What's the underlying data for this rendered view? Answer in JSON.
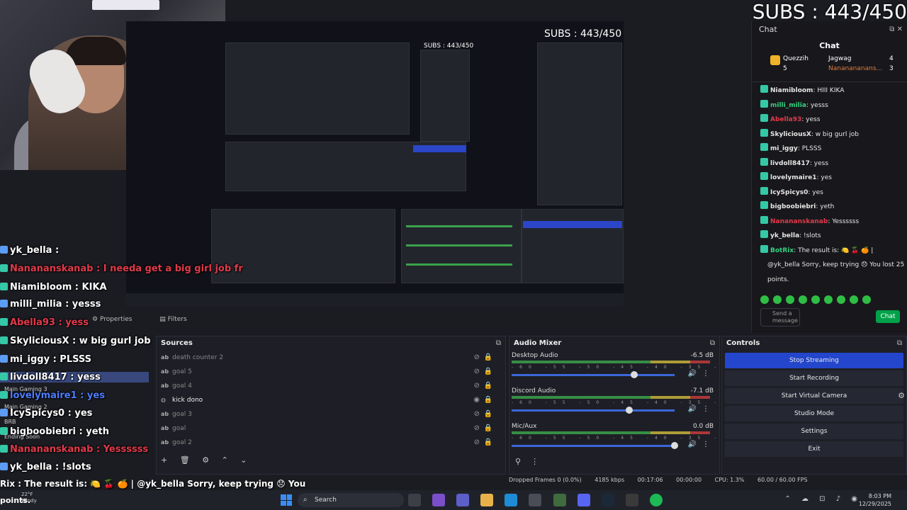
{
  "subs_overlay": {
    "text": "SUBS : 443/450",
    "mini_text": "SUBS : 443/450",
    "mini_text2": "SUBS : 443/450"
  },
  "overlay_chat": [
    {
      "name": "yk_bella",
      "text": "yk_bella :",
      "color": "white"
    },
    {
      "name": "Nanananskanab",
      "text": "Nanananskanab : I needa get a big girl job fr",
      "color": "red"
    },
    {
      "name": "Niamibloom",
      "text": "Niamibloom : KIKA",
      "color": "white"
    },
    {
      "name": "milli_milia",
      "text": "milli_milia : yesss",
      "color": "white"
    },
    {
      "name": "Abella93",
      "text": "Abella93 : yess",
      "color": "red"
    },
    {
      "name": "SkyliciousX",
      "text": "SkyliciousX : w big gurl job",
      "color": "white"
    },
    {
      "name": "mi_iggy",
      "text": "mi_iggy : PLSSS",
      "color": "white"
    },
    {
      "name": "livdoll8417",
      "text": "livdoll8417 : yess",
      "color": "white"
    },
    {
      "name": "lovelymaire1",
      "text": "lovelymaire1 : yes",
      "color": "blue"
    },
    {
      "name": "IcySpicys0",
      "text": "IcySpicys0 : yes",
      "color": "white"
    },
    {
      "name": "bigboobiebri",
      "text": "bigboobiebri : yeth",
      "color": "white"
    },
    {
      "name": "Nanananskanab",
      "text": "Nanananskanab : Yessssss",
      "color": "red"
    },
    {
      "name": "yk_bella",
      "text": "yk_bella : !slots",
      "color": "white"
    }
  ],
  "overlay_small": [
    "Main Gaming 3",
    "Main Gaming 2",
    "BRB",
    "Ending Soon"
  ],
  "result_line": "Rix : The result is:  🍋  🍒  🍊  | @yk_bella Sorry, keep trying 😞 You",
  "result_points": "points.",
  "chat_panel": {
    "header": "Chat",
    "title": "Chat",
    "leaders": [
      {
        "name": "Quezzih",
        "value": "5"
      },
      {
        "name": "Jagwag",
        "value": "4"
      },
      {
        "name": "Nananananans...",
        "value": "3"
      }
    ],
    "messages": [
      {
        "user": "Niamibloom",
        "text": ": HIII KIKA",
        "style": "n"
      },
      {
        "user": "milli_milia",
        "text": ": yesss",
        "style": "green"
      },
      {
        "user": "Abella93",
        "text": ": yess",
        "style": "red"
      },
      {
        "user": "SkyliciousX",
        "text": ": w big gurl job",
        "style": "n"
      },
      {
        "user": "mi_iggy",
        "text": ": PLSSS",
        "style": "n"
      },
      {
        "user": "livdoll8417",
        "text": ": yess",
        "style": "n"
      },
      {
        "user": "lovelymaire1",
        "text": ": yes",
        "style": "n"
      },
      {
        "user": "IcySpicys0",
        "text": ": yes",
        "style": "n"
      },
      {
        "user": "bigboobiebri",
        "text": ": yeth",
        "style": "n"
      },
      {
        "user": "Nanananskanab",
        "text": ": Yessssss",
        "style": "red"
      },
      {
        "user": "yk_bella",
        "text": ": !slots",
        "style": "n"
      },
      {
        "user": "BotRix",
        "text": ": The result is: 🍋 🍒 🍊 |",
        "style": "green"
      },
      {
        "user": "",
        "text": "@yk_bella Sorry, keep trying 😞 You lost 25",
        "style": "plain"
      },
      {
        "user": "",
        "text": "points.",
        "style": "plain"
      }
    ],
    "input_placeholder": "Send a message",
    "chat_button": "Chat"
  },
  "obs": {
    "tabs": {
      "properties": "Properties",
      "filters": "Filters"
    },
    "sources": {
      "title": "Sources",
      "items": [
        {
          "label": "death counter 2",
          "type": "ab",
          "active": false
        },
        {
          "label": "goal 5",
          "type": "ab",
          "active": false
        },
        {
          "label": "goal 4",
          "type": "ab",
          "active": false
        },
        {
          "label": "kick dono",
          "type": "globe",
          "active": true
        },
        {
          "label": "goal 3",
          "type": "ab",
          "active": false
        },
        {
          "label": "goal",
          "type": "ab",
          "active": false
        },
        {
          "label": "goal 2",
          "type": "ab",
          "active": false
        }
      ],
      "footer_icons": [
        "add-icon",
        "trash-icon",
        "gear-icon",
        "up-icon",
        "down-icon"
      ]
    },
    "mixer": {
      "title": "Audio Mixer",
      "channels": [
        {
          "name": "Desktop Audio",
          "db": "-6.5 dB",
          "level": 0.75
        },
        {
          "name": "Discord Audio",
          "db": "-7.1 dB",
          "level": 0.72
        },
        {
          "name": "Mic/Aux",
          "db": "0.0 dB",
          "level": 1.0
        }
      ],
      "scale": "-60 -55 -50 -45 -40 -35 -30 -25 -20 -15 -10 -5 0"
    },
    "controls": {
      "title": "Controls",
      "buttons": [
        "Stop Streaming",
        "Start Recording",
        "Start Virtual Camera",
        "Studio Mode",
        "Settings",
        "Exit"
      ]
    },
    "status": {
      "dropped": "Dropped Frames 0 (0.0%)",
      "bitrate": "4185 kbps",
      "stream_time": "00:17:06",
      "rec_time": "00:00:00",
      "cpu": "CPU: 1.3%",
      "fps": "60.00 / 60.00 FPS"
    }
  },
  "taskbar": {
    "weather_temp": "22°F",
    "weather_desc": "Windy",
    "search": "Search",
    "time": "8:03 PM",
    "date": "12/29/2025"
  },
  "colors": {
    "stream_button": "#2346cc",
    "chat_button": "#00a148",
    "red_user": "#e23a4a"
  }
}
